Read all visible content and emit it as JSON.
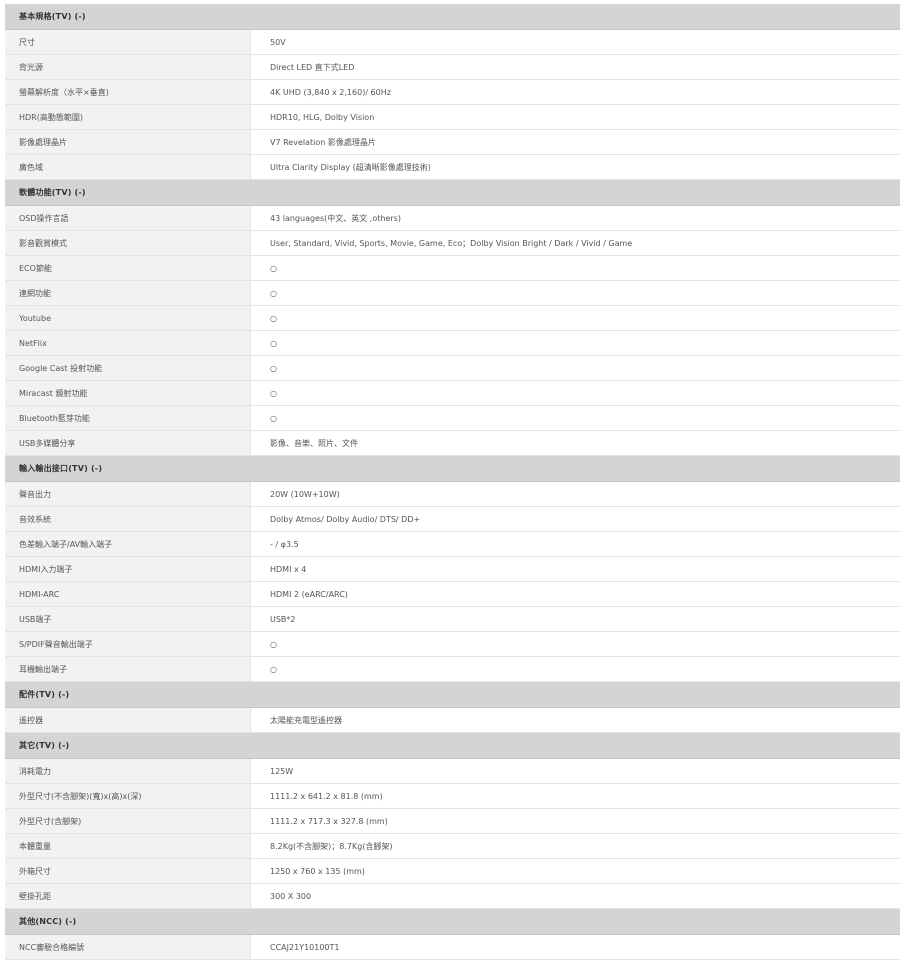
{
  "sections": [
    {
      "title": "基本規格(TV) (-)",
      "rows": [
        {
          "label": "尺寸",
          "value": "50V"
        },
        {
          "label": "背光源",
          "value": "Direct LED 直下式LED"
        },
        {
          "label": "螢幕解析度（水平×垂直)",
          "value": "4K UHD (3,840 x 2,160)/ 60Hz"
        },
        {
          "label": "HDR(高動態範圍)",
          "value": "HDR10, HLG, Dolby Vision"
        },
        {
          "label": "影像處理晶片",
          "value": "V7 Revelation 影像處理晶片"
        },
        {
          "label": "廣色域",
          "value": "Ultra Clarity Display (超清晰影像處理技術)"
        }
      ]
    },
    {
      "title": "軟體功能(TV) (-)",
      "rows": [
        {
          "label": "OSD操作言語",
          "value": "43 languages(中文、英文 ,others)"
        },
        {
          "label": "影音觀賞模式",
          "value": "User, Standard, Vivid, Sports, Movie, Game, Eco；Dolby Vision Bright / Dark / Vivid / Game"
        },
        {
          "label": "ECO節能",
          "value": "○"
        },
        {
          "label": "連網功能",
          "value": "○"
        },
        {
          "label": "Youtube",
          "value": "○"
        },
        {
          "label": "NetFlix",
          "value": "○"
        },
        {
          "label": "Google Cast 投射功能",
          "value": "○"
        },
        {
          "label": "Miracast 鏡射功能",
          "value": "○"
        },
        {
          "label": "Bluetooth藍芽功能",
          "value": "○"
        },
        {
          "label": "USB多媒體分享",
          "value": "影像、音樂、照片、文件"
        }
      ]
    },
    {
      "title": "輸入輸出接口(TV) (-)",
      "rows": [
        {
          "label": "聲音出力",
          "value": "20W (10W+10W)"
        },
        {
          "label": "音效系統",
          "value": "Dolby Atmos/ Dolby Audio/ DTS/ DD+"
        },
        {
          "label": "色差輸入端子/AV輸入端子",
          "value": "- / φ3.5"
        },
        {
          "label": "HDMI入力端子",
          "value": "HDMI x 4"
        },
        {
          "label": "HDMI-ARC",
          "value": "HDMI 2 (eARC/ARC)"
        },
        {
          "label": "USB端子",
          "value": "USB*2"
        },
        {
          "label": "S/PDIF聲音輸出端子",
          "value": "○"
        },
        {
          "label": "耳機輸出端子",
          "value": "○"
        }
      ]
    },
    {
      "title": "配件(TV) (-)",
      "rows": [
        {
          "label": "遙控器",
          "value": "太陽能充電型遙控器"
        }
      ]
    },
    {
      "title": "其它(TV) (-)",
      "rows": [
        {
          "label": "消耗電力",
          "value": "125W"
        },
        {
          "label": "外型尺寸(不含腳架)(寬)x(高)x(深)",
          "value": "1111.2 x 641.2 x 81.8 (mm)"
        },
        {
          "label": "外型尺寸(含腳架)",
          "value": "1111.2 x 717.3 x 327.8 (mm)"
        },
        {
          "label": "本體重量",
          "value": "8.2Kg(不含腳架)；8.7Kg(含腳架)"
        },
        {
          "label": "外箱尺寸",
          "value": "1250 x 760 x 135 (mm)"
        },
        {
          "label": "壁掛孔距",
          "value": "300 X 300"
        }
      ]
    },
    {
      "title": "其他(NCC) (-)",
      "rows": [
        {
          "label": "NCC審驗合格編號",
          "value": "CCAJ21Y10100T1"
        }
      ]
    }
  ]
}
